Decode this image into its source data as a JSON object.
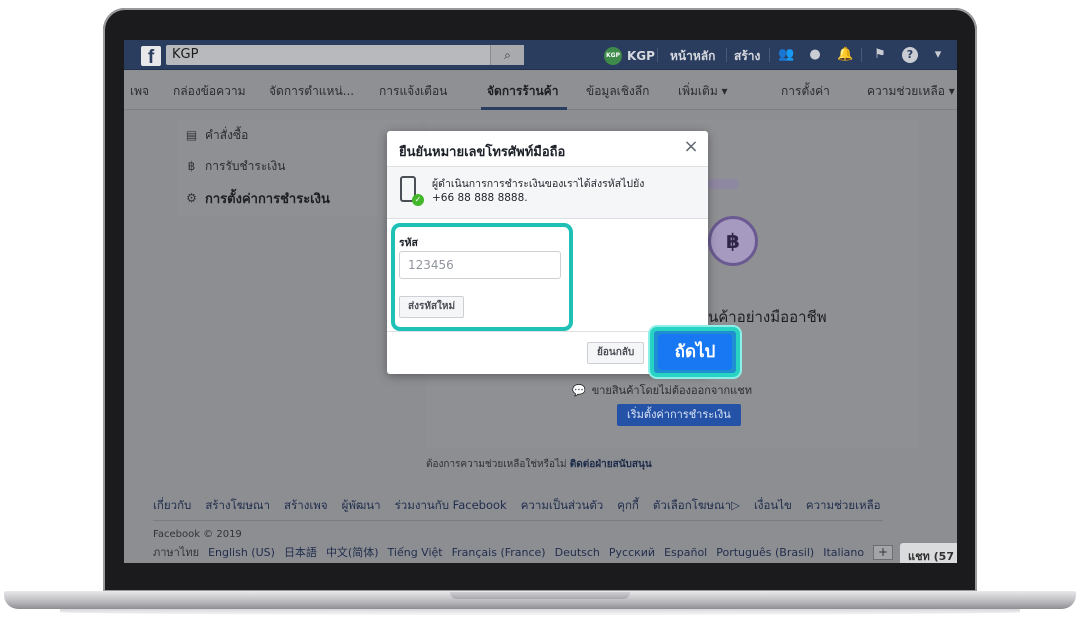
{
  "topbar": {
    "logo": "f",
    "search_value": "KGP",
    "search_icon": "search-icon",
    "profile_avatar": "KGP",
    "profile_name": "KGP",
    "home_label": "หน้าหลัก",
    "create_label": "สร้าง"
  },
  "pagenav": {
    "items": [
      "เพจ",
      "กล่องข้อความ",
      "จัดการตำแหน่...",
      "การแจ้งเตือน",
      "จัดการร้านค้า",
      "ข้อมูลเชิงลึก",
      "เพิ่มเติม ▾",
      "การตั้งค่า",
      "ความช่วยเหลือ ▾"
    ],
    "active": "จัดการร้านค้า"
  },
  "left_menu": {
    "items": [
      {
        "label": "คำสั่งซื้อ",
        "icon": "receipt-icon"
      },
      {
        "label": "การรับชำระเงิน",
        "icon": "baht-icon"
      },
      {
        "label": "การตั้งค่าการชำระเงิน",
        "icon": "gear-icon"
      }
    ]
  },
  "content": {
    "baht_symbol": "฿",
    "headline": "นค้าอย่างมืออาชีพ",
    "subline": "ขายสินค้าโดยไม่ต้องออกจากแชท",
    "start_button": "เริ่มตั้งค่าการชำระเงิน",
    "help_text": "ต้องการความช่วยเหลือใช่หรือไม่",
    "help_link": "ติดต่อฝ่ายสนับสนุน"
  },
  "modal": {
    "title": "ยืนยันหมายเลขโทรศัพท์มือถือ",
    "close": "×",
    "info_line1": "ผู้ดำเนินการการชำระเงินของเราได้ส่งรหัสไปยัง",
    "info_line2": "+66 88 888 8888.",
    "code_label": "รหัส",
    "code_placeholder": "123456",
    "resend_button": "ส่งรหัสใหม่",
    "back_button": "ย้อนกลับ",
    "next_button": "ถัดไป"
  },
  "footer": {
    "links": [
      "เกี่ยวกับ",
      "สร้างโฆษณา",
      "สร้างเพจ",
      "ผู้พัฒนา",
      "ร่วมงานกับ Facebook",
      "ความเป็นส่วนตัว",
      "คุกกี้",
      "ตัวเลือกโฆษณา▷",
      "เงื่อนไข",
      "ความช่วยเหลือ"
    ],
    "copyright": "Facebook © 2019",
    "language_label": "ภาษาไทย",
    "languages": [
      "English (US)",
      "日本語",
      "中文(简体)",
      "Tiếng Việt",
      "Français (France)",
      "Deutsch",
      "Русский",
      "Español",
      "Português (Brasil)",
      "Italiano"
    ],
    "more_languages": "+",
    "chat_tab": "แชท (57"
  },
  "colors": {
    "highlight": "#1fc1b6",
    "primary": "#1877f2",
    "topbar": "#2b3d5e"
  }
}
